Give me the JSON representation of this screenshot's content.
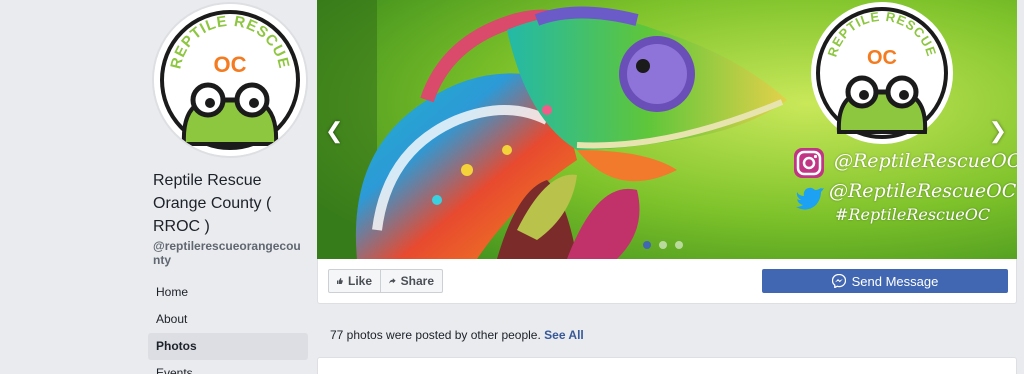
{
  "page": {
    "name": "Reptile Rescue Orange County ( RROC )",
    "handle": "@reptilerescueorangecounty"
  },
  "logo": {
    "top_text": "REPTILE RESCUE",
    "main_text": "OC"
  },
  "nav": {
    "items": [
      {
        "label": "Home"
      },
      {
        "label": "About"
      },
      {
        "label": "Photos"
      },
      {
        "label": "Events"
      }
    ],
    "active": "Photos"
  },
  "cover": {
    "social_instagram": "@ReptileRescueOC",
    "social_twitter": "@ReptileRescueOC",
    "hashtag": "#ReptileRescueOC",
    "slide_count": 3,
    "active_slide": 1
  },
  "actions": {
    "like_label": "Like",
    "share_label": "Share",
    "message_label": "Send Message"
  },
  "photos": {
    "note": "77 photos were posted by other people.",
    "see_all": "See All"
  },
  "colors": {
    "accent": "#4267b2",
    "logo_green": "#8dc63f",
    "logo_orange": "#f47b20"
  }
}
